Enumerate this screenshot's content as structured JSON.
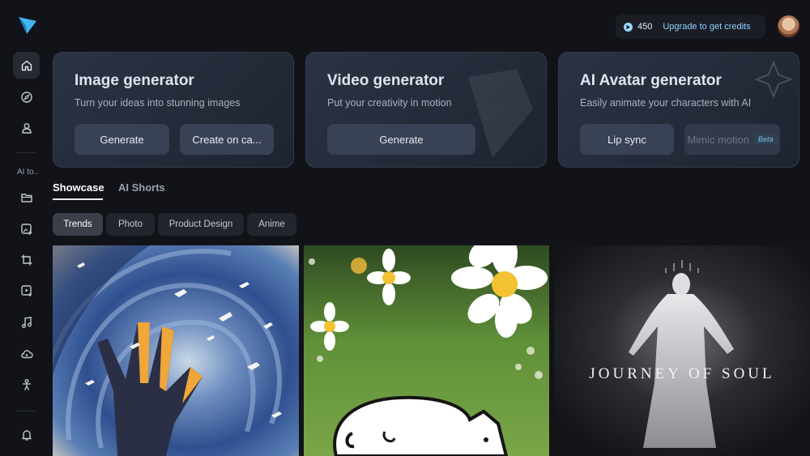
{
  "header": {
    "credits_amount": "450",
    "upgrade_label": "Upgrade to get credits"
  },
  "sidebar": {
    "section_label": "AI to..",
    "items": [
      "home",
      "explore",
      "profile",
      "assets",
      "image-edit",
      "crop",
      "video",
      "music",
      "cloud",
      "character",
      "notifications"
    ]
  },
  "cards": [
    {
      "title": "Image generator",
      "subtitle": "Turn your ideas into stunning images",
      "buttons": [
        "Generate",
        "Create on ca..."
      ]
    },
    {
      "title": "Video generator",
      "subtitle": "Put your creativity in motion",
      "buttons": [
        "Generate"
      ]
    },
    {
      "title": "AI Avatar generator",
      "subtitle": "Easily animate your characters with AI",
      "buttons": [
        "Lip sync",
        "Mimic motion"
      ],
      "badge": "Beta"
    }
  ],
  "tabs": [
    "Showcase",
    "AI Shorts"
  ],
  "filters": [
    "Trends",
    "Photo",
    "Product Design",
    "Anime"
  ],
  "gallery": {
    "tile3_text": "JOURNEY OF SOUL"
  },
  "colors": {
    "background": "#121319",
    "accent": "#8fd3ff",
    "card": "#2b3344"
  }
}
